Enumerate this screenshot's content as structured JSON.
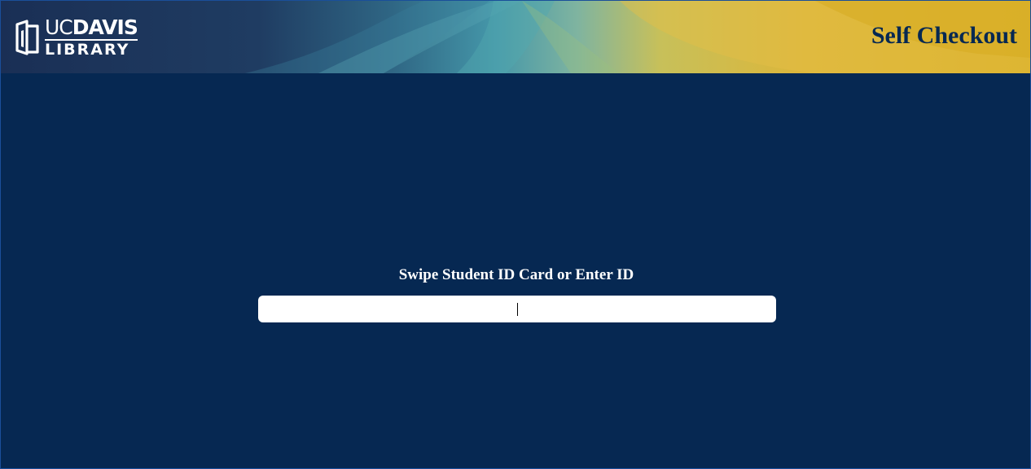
{
  "header": {
    "logo": {
      "top_left": "UC",
      "top_right": "DAVIS",
      "bottom": "LIBRARY",
      "icon": "uc-davis-library-logo-icon"
    },
    "title": "Self Checkout"
  },
  "main": {
    "prompt": "Swipe Student ID Card or Enter ID",
    "id_input": {
      "value": "",
      "placeholder": ""
    }
  },
  "colors": {
    "background": "#062852",
    "title_text": "#062852",
    "gold": "#dcb52e",
    "teal": "#3f9cab"
  }
}
